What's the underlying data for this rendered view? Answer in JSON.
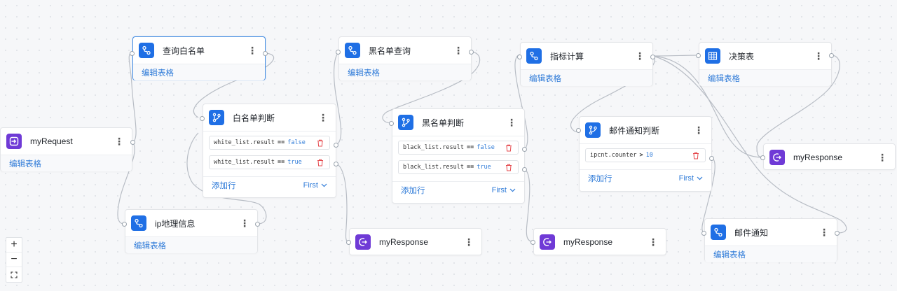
{
  "nodes": {
    "my_request": {
      "title": "myRequest",
      "link": "编辑表格",
      "icon": "entry-icon"
    },
    "whitelist_query": {
      "title": "查询白名单",
      "link": "编辑表格",
      "icon": "branch-flow-icon"
    },
    "ip_geo": {
      "title": "ip地理信息",
      "link": "编辑表格",
      "icon": "branch-flow-icon"
    },
    "whitelist_judge": {
      "title": "白名单判断",
      "icon": "git-branch-icon",
      "conditions": [
        {
          "field": "white_list.result",
          "op": "==",
          "value": "false"
        },
        {
          "field": "white_list.result",
          "op": "==",
          "value": "true"
        }
      ],
      "add_row": "添加行",
      "policy": "First"
    },
    "blacklist_query": {
      "title": "黑名单查询",
      "link": "编辑表格",
      "icon": "branch-flow-icon"
    },
    "blacklist_judge": {
      "title": "黑名单判断",
      "icon": "git-branch-icon",
      "conditions": [
        {
          "field": "black_list.result",
          "op": "==",
          "value": "false"
        },
        {
          "field": "black_list.result",
          "op": "==",
          "value": "true"
        }
      ],
      "add_row": "添加行",
      "policy": "First"
    },
    "response_1": {
      "title": "myResponse",
      "icon": "exit-icon"
    },
    "response_2": {
      "title": "myResponse",
      "icon": "exit-icon"
    },
    "indicator_calc": {
      "title": "指标计算",
      "link": "编辑表格",
      "icon": "branch-flow-icon"
    },
    "mail_judge": {
      "title": "邮件通知判断",
      "icon": "git-branch-icon",
      "conditions": [
        {
          "field": "ipcnt.counter",
          "op": ">",
          "value": "10"
        }
      ],
      "add_row": "添加行",
      "policy": "First"
    },
    "decision_table": {
      "title": "决策表",
      "link": "编辑表格",
      "icon": "table-icon"
    },
    "response_3": {
      "title": "myResponse",
      "icon": "exit-icon"
    },
    "mail_notify": {
      "title": "邮件通知",
      "link": "编辑表格",
      "icon": "branch-flow-icon"
    }
  },
  "zoom_controls": {
    "zoom_in": "+",
    "zoom_out": "−",
    "fit": "fit-view-icon"
  },
  "colors": {
    "node_icon": "#1f6fe5",
    "response_icon": "#6f3ad6",
    "link": "#2f7bd8",
    "delete": "#e5484d",
    "selected_border": "#4a90e2"
  }
}
